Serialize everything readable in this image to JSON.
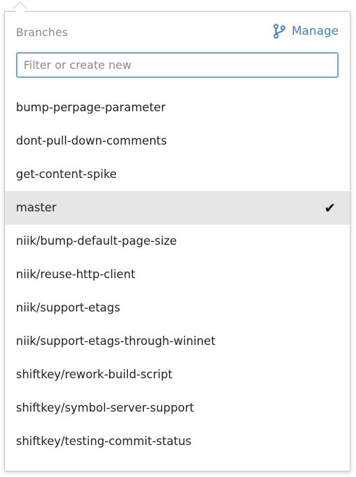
{
  "header": {
    "title": "Branches",
    "manage_label": "Manage"
  },
  "filter": {
    "placeholder": "Filter or create new",
    "value": ""
  },
  "branches": [
    {
      "name": "bump-perpage-parameter"
    },
    {
      "name": "dont-pull-down-comments"
    },
    {
      "name": "get-content-spike"
    },
    {
      "name": "master",
      "selected": true,
      "check": "✔"
    },
    {
      "name": "niik/bump-default-page-size"
    },
    {
      "name": "niik/reuse-http-client"
    },
    {
      "name": "niik/support-etags"
    },
    {
      "name": "niik/support-etags-through-wininet"
    },
    {
      "name": "shiftkey/rework-build-script"
    },
    {
      "name": "shiftkey/symbol-server-support"
    },
    {
      "name": "shiftkey/testing-commit-status"
    }
  ],
  "colors": {
    "accent": "#3f7fbf",
    "focus_border": "#6ea5d6",
    "selected_bg": "#e6e6e6"
  },
  "icons": {
    "manage": "git-branch-icon",
    "selected": "checkmark-icon"
  }
}
